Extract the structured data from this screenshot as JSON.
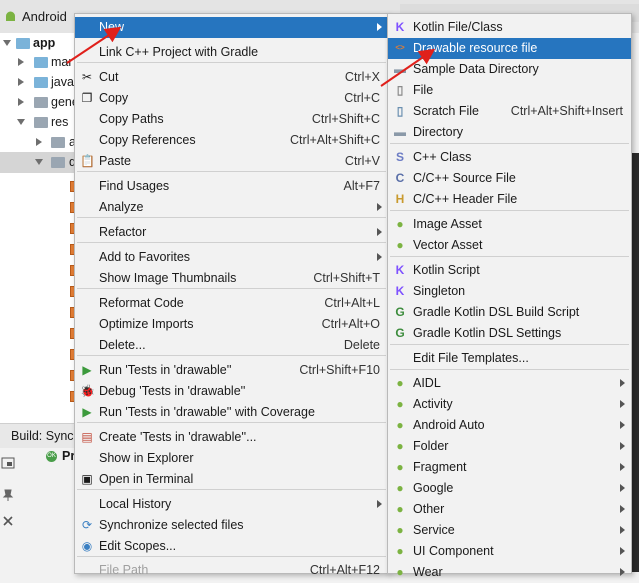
{
  "ide": {
    "project_view_label": "Android",
    "tree": [
      {
        "label": "app",
        "bold": true
      },
      {
        "label": "mar"
      },
      {
        "label": "java"
      },
      {
        "label": "gene"
      },
      {
        "label": "res"
      },
      {
        "label": "a"
      },
      {
        "label": "d"
      }
    ],
    "build_tab_label": "Build: Sync",
    "build_item_label": "Pr",
    "build_item_badge": "OK"
  },
  "main_menu": {
    "items": [
      {
        "label": "New",
        "shortcut": "",
        "submenu": true,
        "highlighted": true,
        "icon": "none"
      },
      {
        "label": "Link C++ Project with Gradle",
        "shortcut": "",
        "icon": "none"
      },
      {
        "label": "Cut",
        "shortcut": "Ctrl+X",
        "icon": "scissors-icon",
        "glyph": "✂"
      },
      {
        "label": "Copy",
        "shortcut": "Ctrl+C",
        "icon": "copy-icon",
        "glyph": "❐"
      },
      {
        "label": "Copy Paths",
        "shortcut": "Ctrl+Shift+C",
        "icon": "none"
      },
      {
        "label": "Copy References",
        "shortcut": "Ctrl+Alt+Shift+C",
        "icon": "none"
      },
      {
        "label": "Paste",
        "shortcut": "Ctrl+V",
        "icon": "clipboard-icon",
        "glyph": "📋"
      },
      {
        "label": "Find Usages",
        "shortcut": "Alt+F7",
        "icon": "none"
      },
      {
        "label": "Analyze",
        "shortcut": "",
        "submenu": true,
        "icon": "none"
      },
      {
        "label": "Refactor",
        "shortcut": "",
        "submenu": true,
        "icon": "none"
      },
      {
        "label": "Add to Favorites",
        "shortcut": "",
        "submenu": true,
        "icon": "none"
      },
      {
        "label": "Show Image Thumbnails",
        "shortcut": "Ctrl+Shift+T",
        "icon": "none"
      },
      {
        "label": "Reformat Code",
        "shortcut": "Ctrl+Alt+L",
        "icon": "none"
      },
      {
        "label": "Optimize Imports",
        "shortcut": "Ctrl+Alt+O",
        "icon": "none"
      },
      {
        "label": "Delete...",
        "shortcut": "Delete",
        "icon": "none"
      },
      {
        "label": "Run 'Tests in 'drawable''",
        "shortcut": "Ctrl+Shift+F10",
        "icon": "run-icon",
        "glyph": "▶"
      },
      {
        "label": "Debug 'Tests in 'drawable''",
        "shortcut": "",
        "icon": "debug-icon",
        "glyph": "🐞"
      },
      {
        "label": "Run 'Tests in 'drawable'' with Coverage",
        "shortcut": "",
        "icon": "coverage-icon",
        "glyph": "▶"
      },
      {
        "label": "Create 'Tests in 'drawable''...",
        "shortcut": "",
        "icon": "create-test-icon",
        "glyph": "▤"
      },
      {
        "label": "Show in Explorer",
        "shortcut": "",
        "icon": "none"
      },
      {
        "label": "Open in Terminal",
        "shortcut": "",
        "icon": "terminal-icon",
        "glyph": "▣"
      },
      {
        "label": "Local History",
        "shortcut": "",
        "submenu": true,
        "icon": "none"
      },
      {
        "label": "Synchronize selected files",
        "shortcut": "",
        "icon": "sync-icon",
        "glyph": "⟳"
      },
      {
        "label": "Edit Scopes...",
        "shortcut": "",
        "icon": "scopes-icon",
        "glyph": "◉"
      },
      {
        "label": "File Path",
        "shortcut": "Ctrl+Alt+F12",
        "icon": "none",
        "disabled": true
      }
    ]
  },
  "new_submenu": {
    "items": [
      {
        "label": "Kotlin File/Class",
        "icon": "kotlin-file-icon",
        "glyph": "K"
      },
      {
        "label": "Drawable resource file",
        "icon": "xml-file-icon",
        "glyph": "<>",
        "highlighted": true
      },
      {
        "label": "Sample Data Directory",
        "icon": "folder-icon",
        "glyph": "▬"
      },
      {
        "label": "File",
        "icon": "file-icon",
        "glyph": "▯"
      },
      {
        "label": "Scratch File",
        "shortcut": "Ctrl+Alt+Shift+Insert",
        "icon": "scratch-file-icon",
        "glyph": "▯"
      },
      {
        "label": "Directory",
        "icon": "folder-icon",
        "glyph": "▬"
      },
      {
        "label": "C++ Class",
        "icon": "cpp-class-icon",
        "glyph": "S"
      },
      {
        "label": "C/C++ Source File",
        "icon": "cpp-source-icon",
        "glyph": "C"
      },
      {
        "label": "C/C++ Header File",
        "icon": "cpp-header-icon",
        "glyph": "H"
      },
      {
        "label": "Image Asset",
        "icon": "android-icon",
        "glyph": "●"
      },
      {
        "label": "Vector Asset",
        "icon": "android-icon",
        "glyph": "●"
      },
      {
        "label": "Kotlin Script",
        "icon": "kotlin-script-icon",
        "glyph": "K"
      },
      {
        "label": "Singleton",
        "icon": "kotlin-singleton-icon",
        "glyph": "K"
      },
      {
        "label": "Gradle Kotlin DSL Build Script",
        "icon": "gradle-icon",
        "glyph": "G"
      },
      {
        "label": "Gradle Kotlin DSL Settings",
        "icon": "gradle-icon",
        "glyph": "G"
      },
      {
        "label": "Edit File Templates...",
        "icon": "none"
      },
      {
        "label": "AIDL",
        "icon": "android-icon",
        "glyph": "●",
        "submenu": true
      },
      {
        "label": "Activity",
        "icon": "android-icon",
        "glyph": "●",
        "submenu": true
      },
      {
        "label": "Android Auto",
        "icon": "android-icon",
        "glyph": "●",
        "submenu": true
      },
      {
        "label": "Folder",
        "icon": "android-icon",
        "glyph": "●",
        "submenu": true
      },
      {
        "label": "Fragment",
        "icon": "android-icon",
        "glyph": "●",
        "submenu": true
      },
      {
        "label": "Google",
        "icon": "android-icon",
        "glyph": "●",
        "submenu": true
      },
      {
        "label": "Other",
        "icon": "android-icon",
        "glyph": "●",
        "submenu": true
      },
      {
        "label": "Service",
        "icon": "android-icon",
        "glyph": "●",
        "submenu": true
      },
      {
        "label": "UI Component",
        "icon": "android-icon",
        "glyph": "●",
        "submenu": true
      },
      {
        "label": "Wear",
        "icon": "android-icon",
        "glyph": "●",
        "submenu": true
      }
    ]
  },
  "colors": {
    "highlight": "#2675bf",
    "annotation_arrow": "#e0201b",
    "android_green": "#7cb342"
  }
}
